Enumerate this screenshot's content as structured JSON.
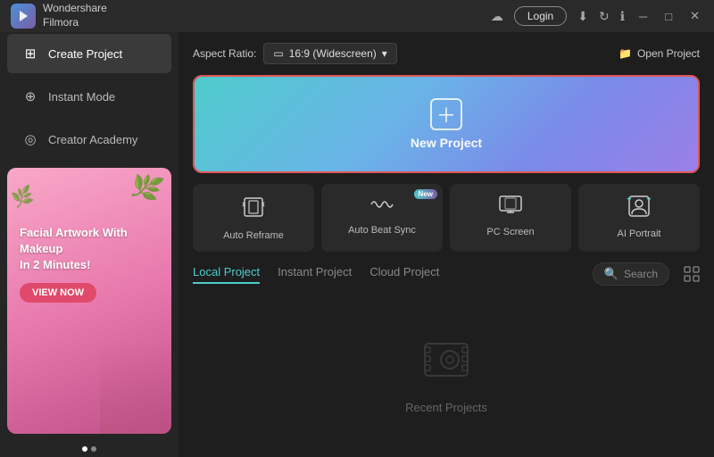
{
  "titlebar": {
    "app_name_line1": "Wondershare",
    "app_name_line2": "Filmora",
    "login_label": "Login"
  },
  "sidebar": {
    "items": [
      {
        "id": "create-project",
        "label": "Create Project",
        "icon": "⊞",
        "active": true
      },
      {
        "id": "instant-mode",
        "label": "Instant Mode",
        "icon": "⊕"
      },
      {
        "id": "creator-academy",
        "label": "Creator Academy",
        "icon": "◎"
      }
    ],
    "promo": {
      "title": "Facial Artwork With Makeup\nIn 2 Minutes!",
      "button_label": "VIEW NOW"
    }
  },
  "content": {
    "aspect_ratio_label": "Aspect Ratio:",
    "aspect_ratio_value": "16:9 (Widescreen)",
    "open_project_label": "Open Project",
    "new_project_label": "New Project",
    "quick_actions": [
      {
        "id": "auto-reframe",
        "label": "Auto Reframe",
        "icon": "⬡",
        "new": false
      },
      {
        "id": "auto-beat-sync",
        "label": "Auto Beat Sync",
        "icon": "〜",
        "new": true
      },
      {
        "id": "pc-screen",
        "label": "PC Screen",
        "icon": "▣",
        "new": false
      },
      {
        "id": "ai-portrait",
        "label": "AI Portrait",
        "icon": "◉",
        "new": false
      }
    ],
    "new_badge_label": "New",
    "tabs": [
      {
        "id": "local",
        "label": "Local Project",
        "active": true
      },
      {
        "id": "instant",
        "label": "Instant Project",
        "active": false
      },
      {
        "id": "cloud",
        "label": "Cloud Project",
        "active": false
      }
    ],
    "search_placeholder": "Search",
    "recent_label": "Recent Projects"
  }
}
